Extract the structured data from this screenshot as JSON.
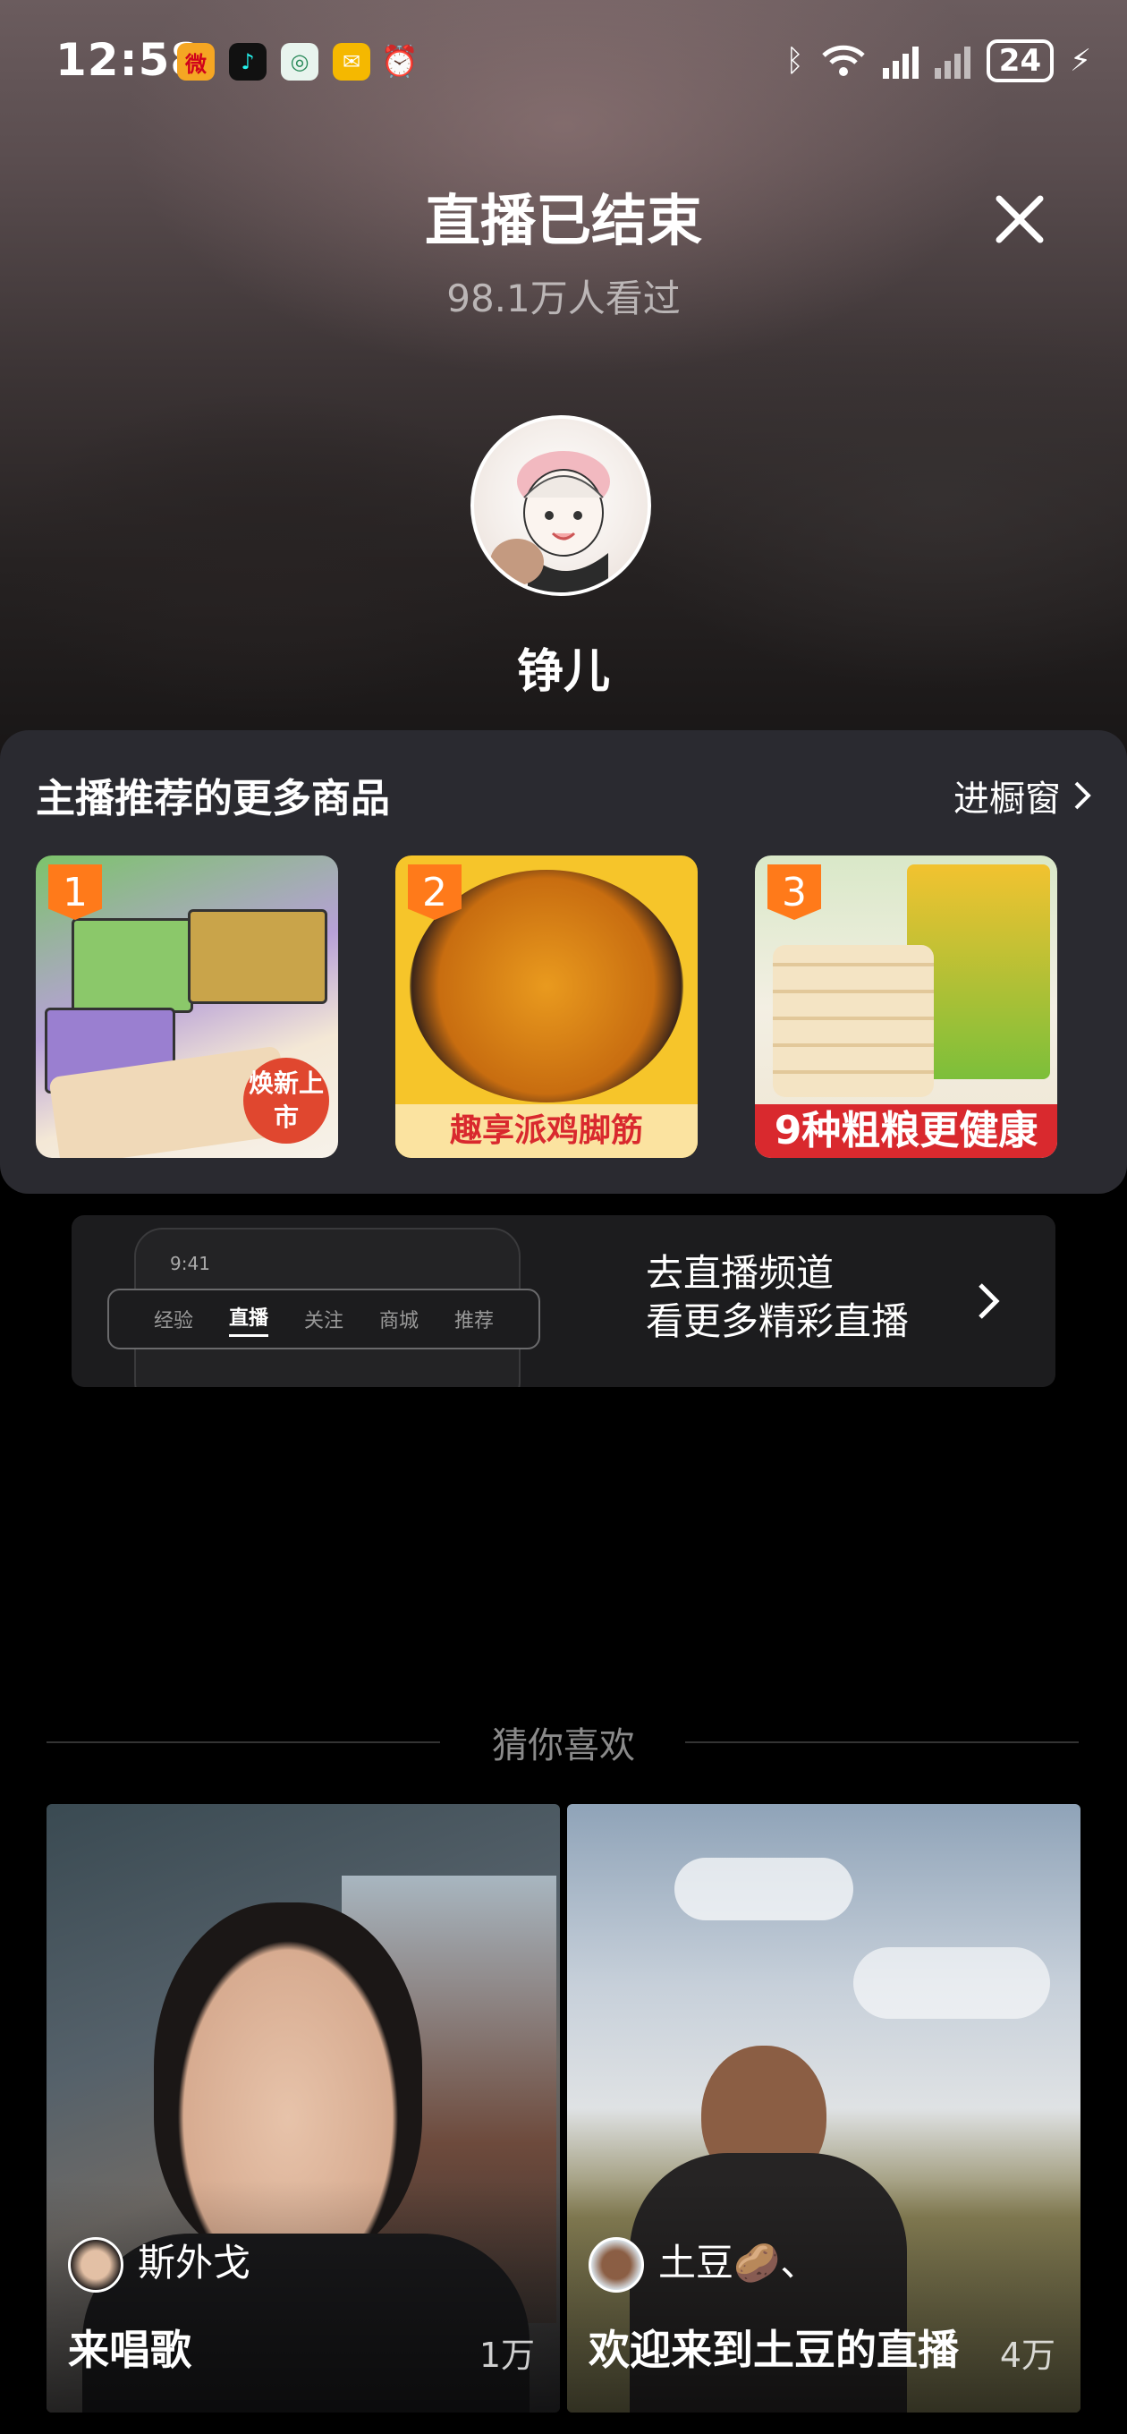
{
  "status_bar": {
    "time": "12:58",
    "battery": "24"
  },
  "header": {
    "title": "直播已结束",
    "viewers": "98.1万人看过"
  },
  "host": {
    "name": "铮儿"
  },
  "products": {
    "title": "主播推荐的更多商品",
    "showcase_link": "进橱窗",
    "items": [
      {
        "rank": "1",
        "tag": "焕新上市"
      },
      {
        "rank": "2",
        "tag": "趣享派鸡脚筋"
      },
      {
        "rank": "3",
        "tag": "9种粗粮更健康"
      }
    ]
  },
  "live_banner": {
    "mock_time": "9:41",
    "tabs": [
      "经验",
      "直播",
      "关注",
      "商城",
      "推荐"
    ],
    "line1": "去直播频道",
    "line2": "看更多精彩直播"
  },
  "recommend": {
    "title": "猜你喜欢",
    "cards": [
      {
        "streamer": "斯外戈",
        "title": "来唱歌",
        "count": "1万"
      },
      {
        "streamer": "土豆🥔、",
        "title": "欢迎来到土豆的直播",
        "count": "4万"
      }
    ]
  },
  "colors": {
    "accent": "#ff7a1a",
    "panel": "#2a2a30",
    "tag_red": "#d9292e"
  }
}
